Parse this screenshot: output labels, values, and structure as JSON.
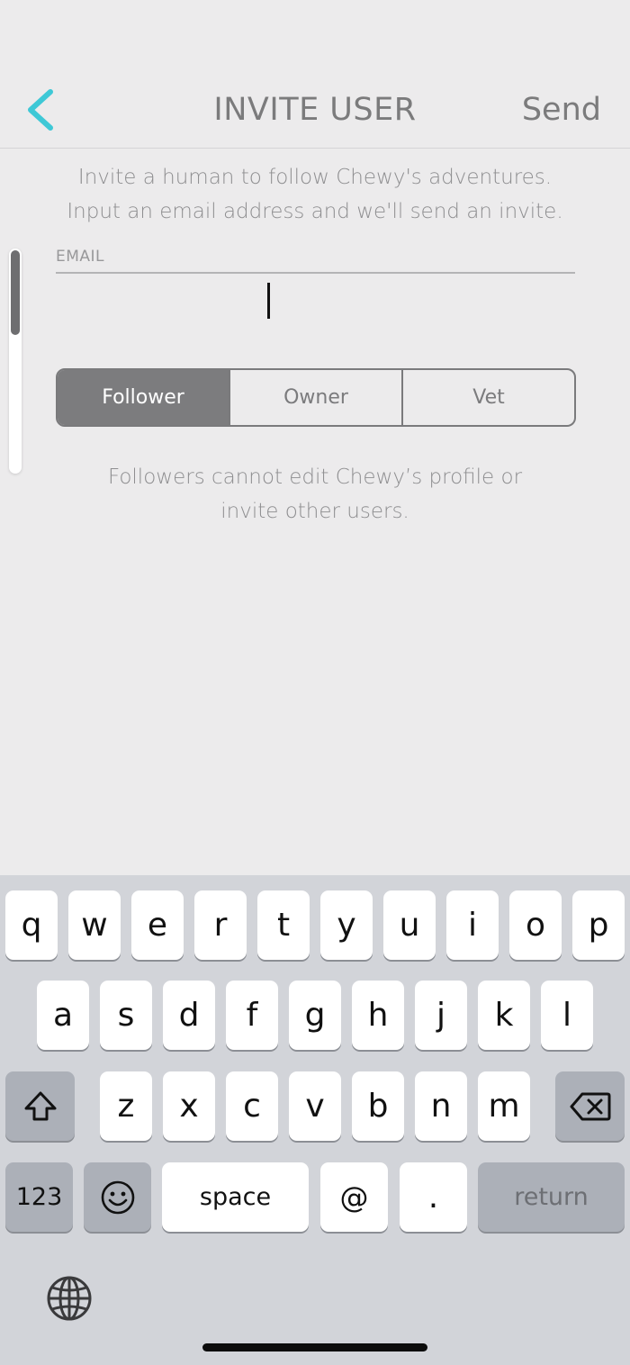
{
  "navbar": {
    "title": "INVITE USER",
    "send_label": "Send",
    "accent_color": "#3ec8d6"
  },
  "content": {
    "intro_line1": "Invite a human to follow Chewy's adventures.",
    "intro_line2": "Input an email address and we'll send an invite.",
    "email_label": "EMAIL",
    "email_value": "",
    "roles": [
      "Follower",
      "Owner",
      "Vet"
    ],
    "selected_role": "Follower",
    "role_description_line1": "Followers cannot edit Chewy’s profile or",
    "role_description_line2": "invite other users."
  },
  "keyboard": {
    "row1": [
      "q",
      "w",
      "e",
      "r",
      "t",
      "y",
      "u",
      "i",
      "o",
      "p"
    ],
    "row2": [
      "a",
      "s",
      "d",
      "f",
      "g",
      "h",
      "j",
      "k",
      "l"
    ],
    "row3": [
      "z",
      "x",
      "c",
      "v",
      "b",
      "n",
      "m"
    ],
    "numbers_label": "123",
    "space_label": "space",
    "at_label": "@",
    "dot_label": ".",
    "return_label": "return",
    "icons": {
      "shift": "shift-icon",
      "delete": "delete-icon",
      "emoji": "emoji-icon",
      "globe": "globe-icon"
    }
  }
}
